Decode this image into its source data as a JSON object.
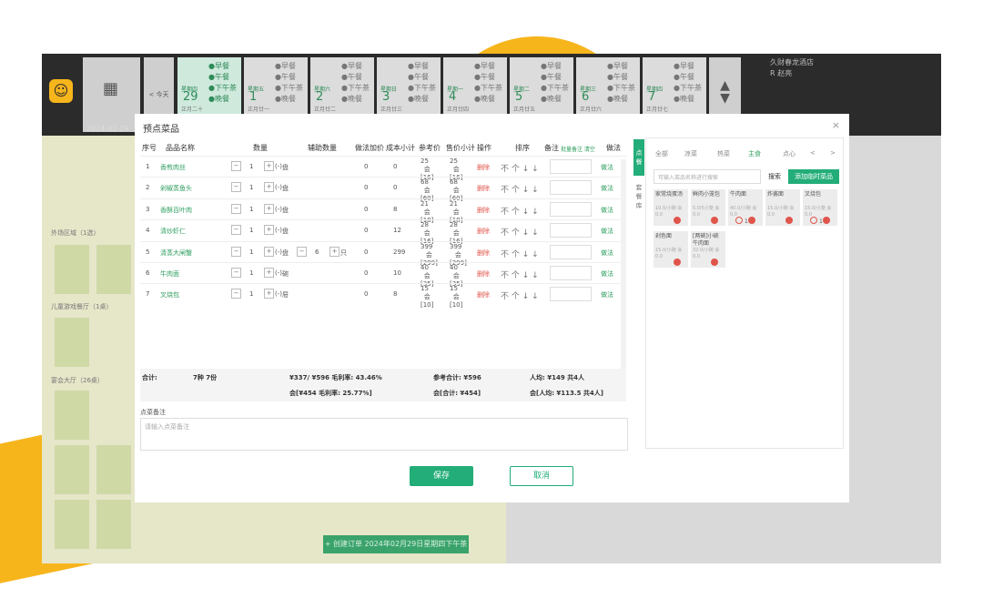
{
  "topbar": {
    "date": "2024-02-29",
    "prev_label": "< 今天",
    "hotel_name": "久财春龙酒店",
    "user_name": "R 赵亮",
    "days": [
      {
        "weekday": "星期四",
        "num": "29",
        "lunar": "正月二十",
        "meals": [
          "早餐",
          "午餐",
          "下午茶",
          "晚餐"
        ],
        "active": true
      },
      {
        "weekday": "星期五",
        "num": "1",
        "lunar": "正月廿一",
        "meals": [
          "早餐",
          "午餐",
          "下午茶",
          "晚餐"
        ]
      },
      {
        "weekday": "星期六",
        "num": "2",
        "lunar": "正月廿二",
        "meals": [
          "早餐",
          "午餐",
          "下午茶",
          "晚餐"
        ]
      },
      {
        "weekday": "星期日",
        "num": "3",
        "lunar": "正月廿三",
        "meals": [
          "早餐",
          "午餐",
          "下午茶",
          "晚餐"
        ]
      },
      {
        "weekday": "星期一",
        "num": "4",
        "lunar": "正月廿四",
        "meals": [
          "早餐",
          "午餐",
          "下午茶",
          "晚餐"
        ]
      },
      {
        "weekday": "星期二",
        "num": "5",
        "lunar": "正月廿五",
        "meals": [
          "早餐",
          "午餐",
          "下午茶",
          "晚餐"
        ]
      },
      {
        "weekday": "星期三",
        "num": "6",
        "lunar": "正月廿六",
        "meals": [
          "早餐",
          "午餐",
          "下午茶",
          "晚餐"
        ]
      },
      {
        "weekday": "星期四",
        "num": "7",
        "lunar": "正月廿七",
        "meals": [
          "早餐",
          "午餐",
          "下午茶",
          "晚餐"
        ]
      }
    ]
  },
  "background": {
    "side_labels": [
      "外场区域（1选）",
      "儿童游戏餐厅（1桌）",
      "宴会大厅（26桌）"
    ],
    "add_order": "+ 创建订单 2024年02月29日星期四下午茶"
  },
  "modal": {
    "title": "预点菜品",
    "close": "×",
    "headers": {
      "seq": "序号",
      "name": "品品名称",
      "qty": "数量",
      "aux_qty": "辅助数量",
      "method_price": "做法加价",
      "cost": "成本小计",
      "ref_price": "参考价",
      "sale_subtotal": "售价小计",
      "op": "操作",
      "sort": "排序",
      "remark": "备注",
      "remark_links": "批量备注 清空",
      "method": "做法"
    },
    "rows": [
      {
        "seq": "1",
        "name": "香煎肉丝",
        "qty": "1",
        "unit": "盘",
        "method_price": "0",
        "cost": "0",
        "ref": "25",
        "ref_sub": "会[16]",
        "sale": "25",
        "sale_sub": "会[16]"
      },
      {
        "seq": "2",
        "name": "剁椒蒸鱼头",
        "qty": "1",
        "unit": "盘",
        "method_price": "0",
        "cost": "0",
        "ref": "68",
        "ref_sub": "会[60]",
        "sale": "68",
        "sale_sub": "会[60]"
      },
      {
        "seq": "3",
        "name": "香酥百叶肉",
        "qty": "1",
        "unit": "盘",
        "method_price": "0",
        "cost": "8",
        "ref": "21",
        "ref_sub": "会[18]",
        "sale": "21",
        "sale_sub": "会[18]"
      },
      {
        "seq": "4",
        "name": "清炒虾仁",
        "qty": "1",
        "unit": "盘",
        "method_price": "0",
        "cost": "12",
        "ref": "28",
        "ref_sub": "会[16]",
        "sale": "28",
        "sale_sub": "会[16]"
      },
      {
        "seq": "5",
        "name": "清蒸大闸蟹",
        "qty": "1",
        "unit": "盘",
        "aux": "6",
        "aux_unit": "只",
        "method_price": "0",
        "cost": "299",
        "ref": "399",
        "ref_sub": "会[299]",
        "sale": "399",
        "sale_sub": "会[299]"
      },
      {
        "seq": "6",
        "name": "牛肉面",
        "qty": "1",
        "unit": "碗",
        "method_price": "0",
        "cost": "10",
        "ref": "40",
        "ref_sub": "会[35]",
        "sale": "40",
        "sale_sub": "会[35]"
      },
      {
        "seq": "7",
        "name": "叉烧包",
        "qty": "1",
        "unit": "屉",
        "method_price": "0",
        "cost": "8",
        "ref": "15",
        "ref_sub": "会[10]",
        "sale": "15",
        "sale_sub": "会[10]"
      }
    ],
    "row_delete": "删除",
    "row_method": "做法",
    "sort_arrows": "不 个 ↓ ↓",
    "summary": {
      "total_label": "合计:",
      "count": "7种 7份",
      "gross1": "¥337/ ¥596 毛利率: 43.46%",
      "gross2": "会[¥454 毛利率: 25.77%]",
      "ref_total": "参考合计: ¥596",
      "member_total": "会[合计: ¥454]",
      "per_person": "人均: ¥149 共4人",
      "per_person_member": "会[人均: ¥113.5 共4人]"
    },
    "remark_label": "点菜备注",
    "remark_placeholder": "请输入点菜备注",
    "save": "保存",
    "cancel": "取消"
  },
  "tabs": [
    "点餐",
    "套餐库"
  ],
  "dish_panel": {
    "categories": [
      "全部",
      "凉菜",
      "热菜",
      "主食",
      "点心"
    ],
    "search_placeholder": "可输入菜品名称进行搜索",
    "search_btn": "搜索",
    "temp_btn": "添加临时菜品",
    "cards": [
      {
        "name": "家常烧蛋汤",
        "price": "10.0/小碗 会0.0",
        "dot": true
      },
      {
        "name": "鲜肉小笼包",
        "price": "5.0/5小笼 会0.0",
        "dot": true
      },
      {
        "name": "牛肉面",
        "price": "40.0/小碗 会0.0",
        "count": "1"
      },
      {
        "name": "炸酱面",
        "price": "15.0/小碗 会0.0",
        "dot": true
      },
      {
        "name": "叉烧包",
        "price": "15.0/小笼 会0.0",
        "count": "1"
      },
      {
        "name": "剁色面",
        "price": "15.0/小碗 会0.0",
        "dot": true
      },
      {
        "name": "[两碗]小碗牛肉面",
        "price": "32.0/小碗 会0.0",
        "dot": true
      }
    ]
  }
}
